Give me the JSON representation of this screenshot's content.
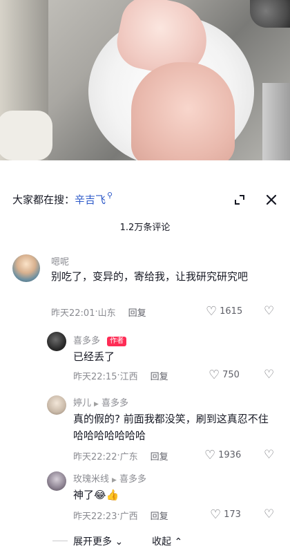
{
  "search": {
    "prefix": "大家都在搜：",
    "keyword": "辛吉飞",
    "icon": "search-icon"
  },
  "comment_count": "1.2万条评论",
  "comments": [
    {
      "user": "嗯呢",
      "text": "别吃了，变异的，寄给我，让我研究研究吧",
      "time": "昨天22:01",
      "location": "山东",
      "reply": "回复",
      "likes": "1615"
    },
    {
      "user": "喜多多",
      "tag": "作者",
      "text": "已经丢了",
      "time": "昨天22:15",
      "location": "江西",
      "reply": "回复",
      "likes": "750"
    },
    {
      "user": "婷儿",
      "reply_to": "喜多多",
      "text": "真的假的? 前面我都没笑，刷到这真忍不住哈哈哈哈哈哈哈",
      "time": "昨天22:22",
      "location": "广东",
      "reply": "回复",
      "likes": "1936"
    },
    {
      "user": "玫瑰米线",
      "reply_to": "喜多多",
      "text": "神了😂👍",
      "time": "昨天22:23",
      "location": "广西",
      "reply": "回复",
      "likes": "173"
    }
  ],
  "footer": {
    "expand": "展开更多",
    "collapse": "收起"
  },
  "colors": {
    "keyword": "#2b58c8",
    "author_tag": "#fe2c55",
    "text": "#161823",
    "meta": "#8a8b91"
  }
}
